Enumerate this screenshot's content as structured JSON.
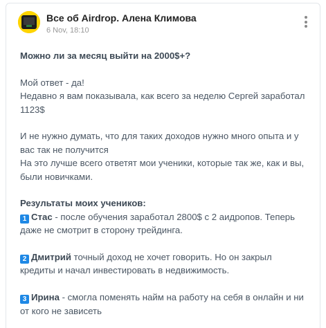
{
  "post": {
    "channel_name": "Все об Airdrop. Алена Климова",
    "date": "6 Nov, 18:10",
    "heading": "Можно ли за месяц выйти на 2000$+?",
    "p1_l1": "Мой ответ - да!",
    "p1_l2": "Недавно я вам показывала, как всего за неделю Сергей заработал 1123$",
    "p2_l1": "И не нужно думать, что для таких доходов нужно много опыта и у вас так не получится",
    "p2_l2": "На это лучше всего ответят мои ученики, которые так же, как и вы, были новичками.",
    "results_heading": "Результаты моих учеников:",
    "students": [
      {
        "num": "1",
        "name": "Стас",
        "text": " - после обучения заработал 2800$ с 2 аидропов. Теперь даже не смотрит в сторону трейдинга."
      },
      {
        "num": "2",
        "name": "Дмитрий",
        "text": " точный доход не хочет говорить. Но он закрыл кредиты и начал инвестировать в недвижимость."
      },
      {
        "num": "3",
        "name": "Ирина",
        "text": " - смогла поменять найм на работу на себя в онлайн и ни от кого не зависеть"
      }
    ]
  },
  "colors": {
    "text": "#4a5663",
    "keycap": "#1e88e5",
    "avatar_bg": "#ffd400"
  },
  "icons": {
    "menu": "more-vertical-icon"
  }
}
